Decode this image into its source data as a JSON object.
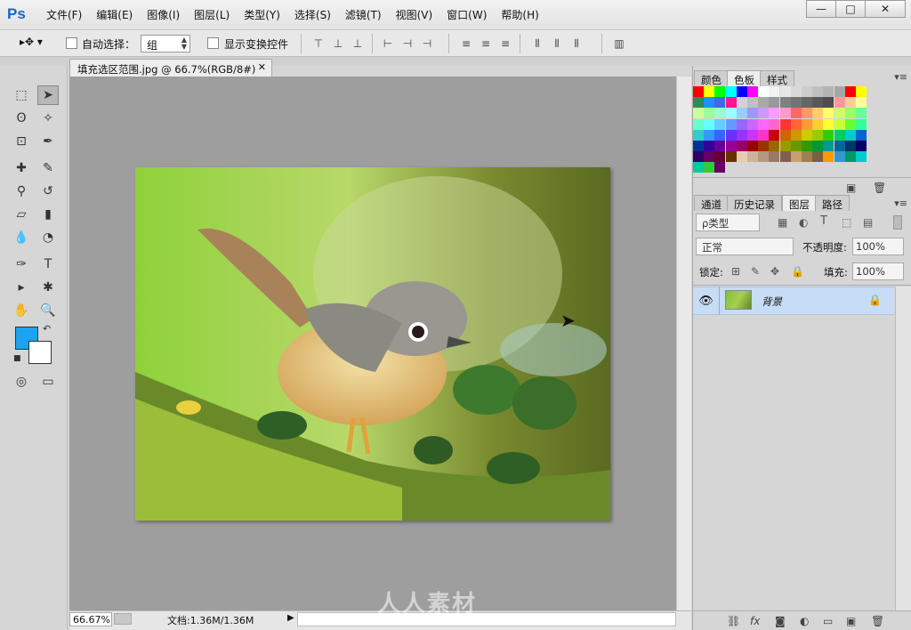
{
  "app": {
    "logo": "Ps"
  },
  "menu": [
    "文件(F)",
    "编辑(E)",
    "图像(I)",
    "图层(L)",
    "类型(Y)",
    "选择(S)",
    "滤镜(T)",
    "视图(V)",
    "窗口(W)",
    "帮助(H)"
  ],
  "window_controls": {
    "minimize": "—",
    "maximize": "□",
    "close": "✕"
  },
  "options": {
    "tool_preset": "▸✥ ▾",
    "auto_select_label": "自动选择：",
    "auto_select_checked": false,
    "group_value": "组",
    "show_transform_label": "显示变换控件",
    "show_transform_checked": false
  },
  "document": {
    "tab_title": "填充选区范围.jpg @ 66.7%(RGB/8#)",
    "tab_close": "✕"
  },
  "status": {
    "zoom": "66.67%",
    "doc_info": "文档:1.36M/1.36M",
    "arrow": "▶"
  },
  "color_panel": {
    "tabs": [
      "颜色",
      "色板",
      "样式"
    ],
    "active_tab": "色板"
  },
  "layers_panel": {
    "tabs": [
      "通道",
      "历史记录",
      "图层",
      "路径"
    ],
    "active_tab": "图层",
    "filter_kind": "ρ类型",
    "blend_mode": "正常",
    "opacity_label": "不透明度:",
    "opacity_value": "100%",
    "lock_label": "锁定:",
    "fill_label": "填充:",
    "fill_value": "100%",
    "layers": [
      {
        "name": "背景",
        "visible": true,
        "locked": true
      }
    ]
  },
  "watermark": "人人素材",
  "colors": {
    "foreground": "#1aa3f0",
    "background": "#ffffff",
    "selected_layer": "#c7dcf5"
  },
  "swatch_colors": [
    [
      "#ff0000",
      "#ffff00",
      "#00ff00",
      "#00ffff",
      "#0000ff",
      "#ff00ff",
      "#ffffff",
      "#f2f2f2",
      "#e6e6e6",
      "#d9d9d9",
      "#cccccc",
      "#bfbfbf",
      "#b3b3b3",
      "#a6a6a6",
      "#ff0000",
      "#ffff00"
    ],
    [
      "#2e8b57",
      "#1e90ff",
      "#4169e1",
      "#ff1493",
      "#d3d3d3",
      "#c0c0c0",
      "#a9a9a9",
      "#999999",
      "#808080",
      "#737373",
      "#666666",
      "#595959",
      "#4d4d4d",
      "#ff9999",
      "#ffcc99",
      "#ffff99"
    ],
    [
      "#ccff99",
      "#99ff99",
      "#99ffcc",
      "#99ffff",
      "#99ccff",
      "#9999ff",
      "#cc99ff",
      "#ff99ff",
      "#ff99cc",
      "#ff6666",
      "#ff9966",
      "#ffcc66",
      "#ffff66",
      "#ccff66",
      "#99ff66",
      "#66ff99"
    ],
    [
      "#66ffcc",
      "#66ffff",
      "#66ccff",
      "#6699ff",
      "#9966ff",
      "#cc66ff",
      "#ff66ff",
      "#ff66cc",
      "#ff3333",
      "#ff6633",
      "#ff9933",
      "#ffcc33",
      "#ffff33",
      "#ccff33",
      "#66ff33",
      "#33ff99"
    ],
    [
      "#33cccc",
      "#3399ff",
      "#3366ff",
      "#6633ff",
      "#9933ff",
      "#cc33ff",
      "#ff33cc",
      "#cc0000",
      "#cc6600",
      "#cc9900",
      "#cccc00",
      "#99cc00",
      "#33cc00",
      "#00cc66",
      "#00cccc",
      "#0066cc"
    ],
    [
      "#003399",
      "#330099",
      "#660099",
      "#990099",
      "#990066",
      "#990000",
      "#993300",
      "#996600",
      "#999900",
      "#669900",
      "#339900",
      "#009933",
      "#009999",
      "#006699",
      "#003366",
      "#000066"
    ],
    [
      "#330066",
      "#660066",
      "#660033",
      "#663300",
      "#e6ccb3",
      "#ccb399",
      "#b39980",
      "#997a66",
      "#806050",
      "#c8a070",
      "#a08050",
      "#786040",
      "#ff9900",
      "#3399cc",
      "#009966",
      "#00cccc"
    ],
    [
      "#00cc99",
      "#33cc33",
      "#660066"
    ]
  ]
}
